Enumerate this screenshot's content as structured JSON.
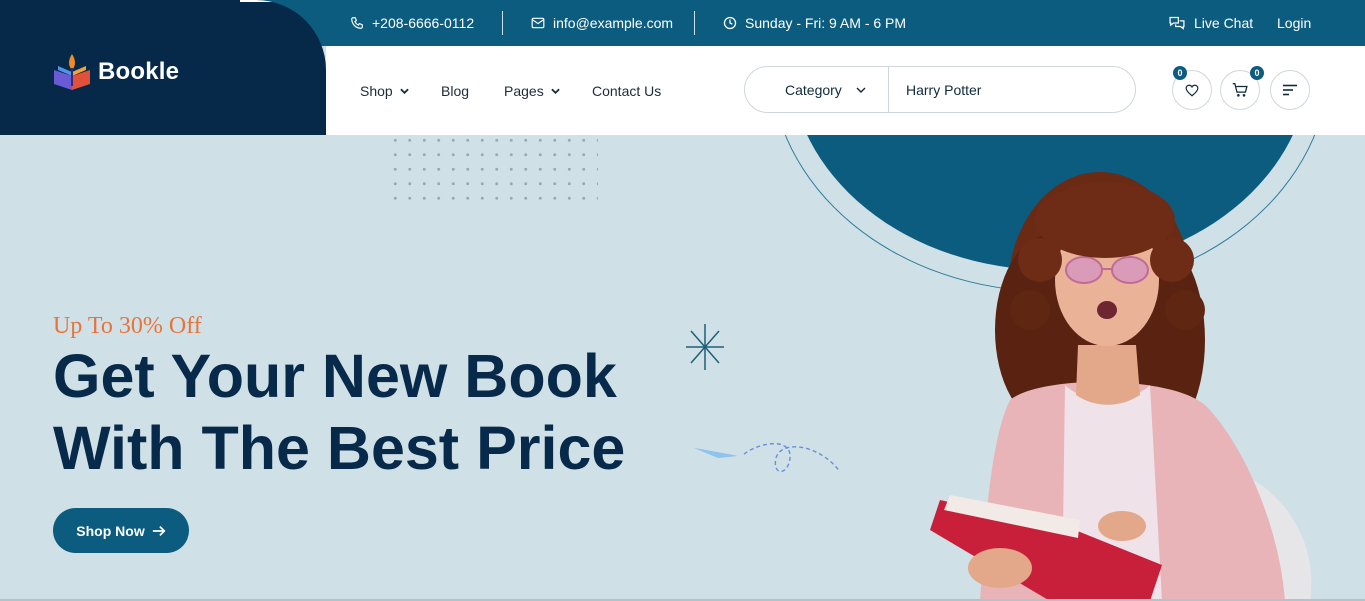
{
  "topbar": {
    "phone": "+208-6666-0112",
    "email": "info@example.com",
    "hours": "Sunday - Fri: 9 AM - 6 PM",
    "live_chat": "Live Chat",
    "login": "Login"
  },
  "brand": {
    "name": "Bookle"
  },
  "nav": {
    "items": [
      {
        "label": "Shop",
        "has_dropdown": true
      },
      {
        "label": "Blog",
        "has_dropdown": false
      },
      {
        "label": "Pages",
        "has_dropdown": true
      },
      {
        "label": "Contact Us",
        "has_dropdown": false
      }
    ]
  },
  "search": {
    "category_label": "Category",
    "value": "Harry Potter"
  },
  "header_actions": {
    "wishlist_count": "0",
    "cart_count": "0"
  },
  "hero": {
    "eyebrow": "Up To 30% Off",
    "headline_line1": "Get Your New Book",
    "headline_line2": "With The Best Price",
    "cta_label": "Shop Now"
  },
  "colors": {
    "primary": "#0b5c7e",
    "dark": "#07294a",
    "accent": "#e8743b",
    "hero_bg": "#cfe0e6"
  },
  "icons": [
    "phone-icon",
    "mail-icon",
    "clock-icon",
    "chat-icon",
    "heart-icon",
    "cart-icon",
    "menu-icon",
    "arrow-right-icon",
    "chevron-down-icon",
    "logo-icon"
  ]
}
